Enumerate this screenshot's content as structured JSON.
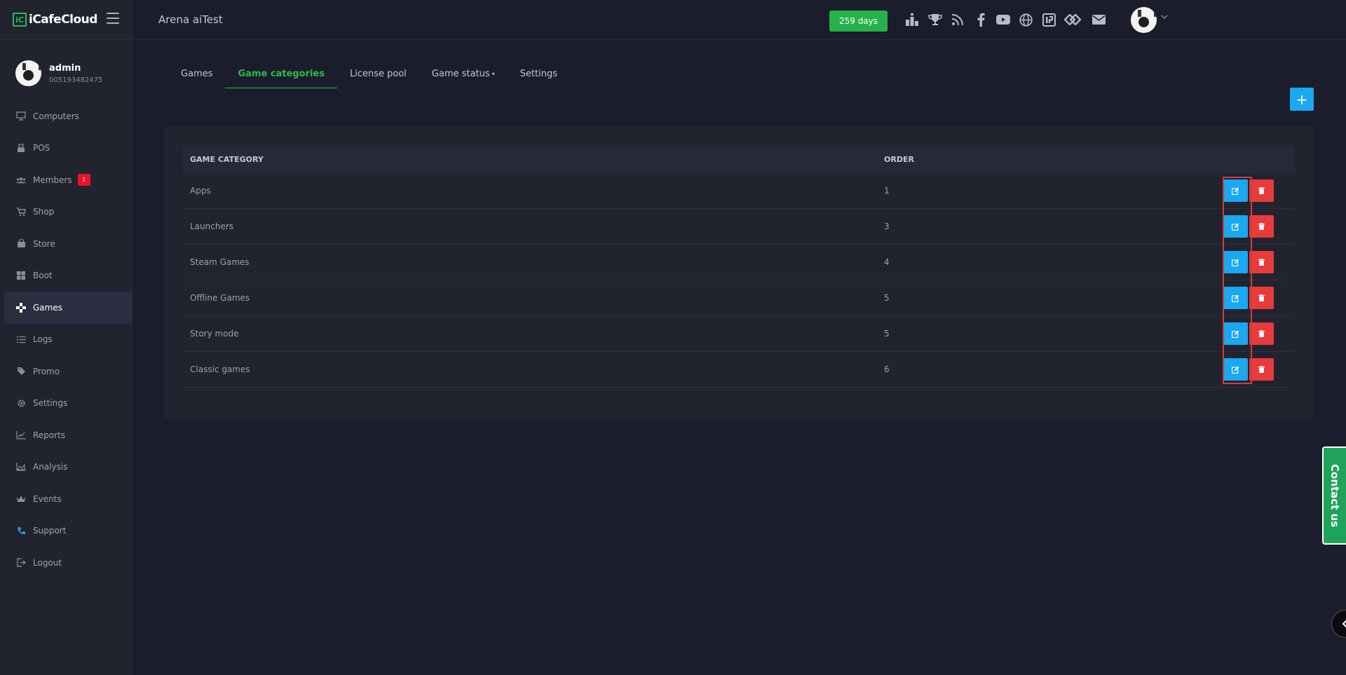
{
  "brand": {
    "logo_mark": "iC",
    "name": "iCafeCloud"
  },
  "user": {
    "name": "admin",
    "id": "005193482475"
  },
  "sidebar": {
    "items": [
      {
        "label": "Computers",
        "icon": "monitor-icon"
      },
      {
        "label": "POS",
        "icon": "cash-register-icon"
      },
      {
        "label": "Members",
        "icon": "users-icon",
        "badge": "1"
      },
      {
        "label": "Shop",
        "icon": "cart-icon"
      },
      {
        "label": "Store",
        "icon": "bag-icon"
      },
      {
        "label": "Boot",
        "icon": "windows-icon"
      },
      {
        "label": "Games",
        "icon": "gamepad-icon",
        "active": true
      },
      {
        "label": "Logs",
        "icon": "list-icon"
      },
      {
        "label": "Promo",
        "icon": "tag-icon"
      },
      {
        "label": "Settings",
        "icon": "gear-icon"
      },
      {
        "label": "Reports",
        "icon": "line-chart-icon"
      },
      {
        "label": "Analysis",
        "icon": "area-chart-icon"
      },
      {
        "label": "Events",
        "icon": "crown-icon"
      },
      {
        "label": "Support",
        "icon": "phone-icon"
      },
      {
        "label": "Logout",
        "icon": "logout-icon"
      }
    ]
  },
  "header": {
    "title": "Arena aiTest",
    "days_label": "259 days",
    "icons": [
      "ranking-icon",
      "trophy-icon",
      "rss-icon",
      "facebook-icon",
      "youtube-icon",
      "globe-icon",
      "icafe-icon",
      "wave-icon",
      "mail-icon"
    ]
  },
  "tabs": [
    {
      "label": "Games"
    },
    {
      "label": "Game categories",
      "active": true
    },
    {
      "label": "License pool"
    },
    {
      "label": "Game status",
      "dropdown": true
    },
    {
      "label": "Settings"
    }
  ],
  "add_button": "+",
  "table": {
    "headers": {
      "name": "GAME CATEGORY",
      "order": "ORDER"
    },
    "rows": [
      {
        "name": "Apps",
        "order": "1"
      },
      {
        "name": "Launchers",
        "order": "3"
      },
      {
        "name": "Steam Games",
        "order": "4"
      },
      {
        "name": "Offline Games",
        "order": "5"
      },
      {
        "name": "Story mode",
        "order": "5"
      },
      {
        "name": "Classic games",
        "order": "6"
      }
    ]
  },
  "contact": {
    "label": "Contact us"
  },
  "colors": {
    "accent_green": "#2dba4e",
    "edit_blue": "#1aa8f0",
    "delete_red": "#e83b3b"
  }
}
